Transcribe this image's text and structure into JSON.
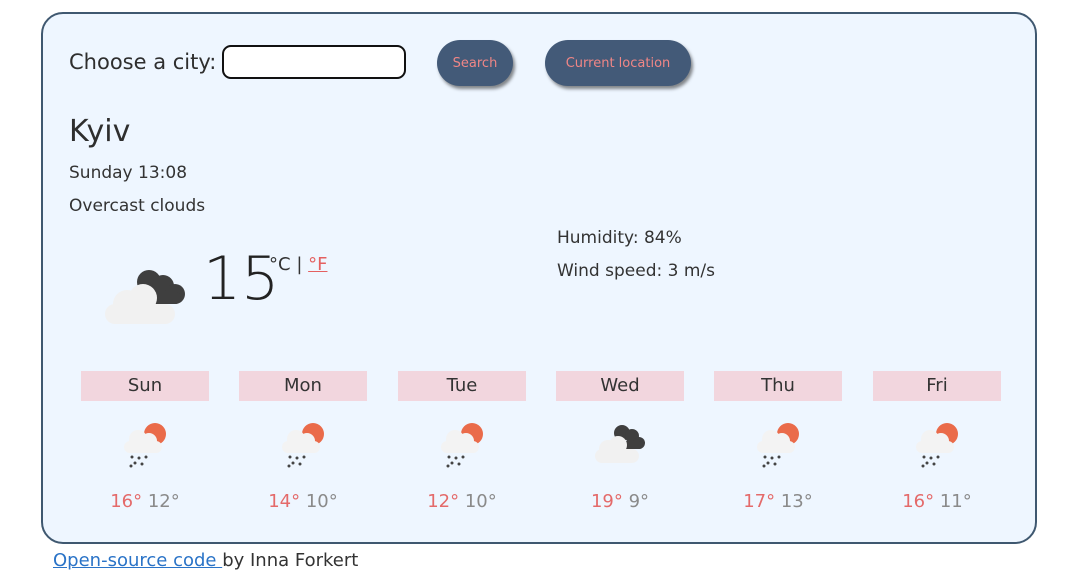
{
  "search": {
    "label": "Choose a city:",
    "value": "",
    "placeholder": "",
    "search_button": "Search",
    "location_button": "Current location"
  },
  "current": {
    "city": "Kyiv",
    "datetime": "Sunday 13:08",
    "description": "Overcast clouds",
    "icon": "overcast-clouds-icon",
    "temperature": "15",
    "unit_c": "°C",
    "unit_sep": "|",
    "unit_f": "°F",
    "humidity": "Humidity: 84%",
    "wind": "Wind speed: 3 m/s"
  },
  "forecast": [
    {
      "day": "Sun",
      "icon": "rain-sun-icon",
      "max": "16°",
      "min": "12°"
    },
    {
      "day": "Mon",
      "icon": "rain-sun-icon",
      "max": "14°",
      "min": "10°"
    },
    {
      "day": "Tue",
      "icon": "rain-sun-icon",
      "max": "12°",
      "min": "10°"
    },
    {
      "day": "Wed",
      "icon": "overcast-clouds-icon",
      "max": "19°",
      "min": "9°"
    },
    {
      "day": "Thu",
      "icon": "rain-sun-icon",
      "max": "17°",
      "min": "13°"
    },
    {
      "day": "Fri",
      "icon": "rain-sun-icon",
      "max": "16°",
      "min": "11°"
    }
  ],
  "footer": {
    "link_text": "Open-source code ",
    "author_text": "by Inna Forkert"
  },
  "colors": {
    "card_bg": "#eef6ff",
    "card_border": "#3f5870",
    "button_bg": "#435a78",
    "button_text": "#f08686",
    "day_label_bg": "#f2d6de",
    "max_temp": "#e46a6a",
    "min_temp": "#8a8a8a",
    "link": "#2a73c7"
  }
}
